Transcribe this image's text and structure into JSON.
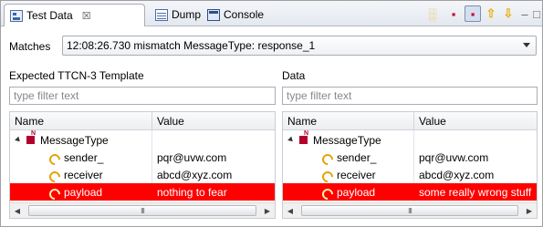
{
  "tabs": [
    {
      "label": "Test Data",
      "icon": "test-data-icon",
      "close": "☒"
    },
    {
      "label": "Dump",
      "icon": "dump-icon"
    },
    {
      "label": "Console",
      "icon": "console-icon"
    }
  ],
  "toolbar": {
    "icons": [
      "error-filter-icon",
      "type-filter-icon",
      "show-type-icon",
      "previous-icon",
      "next-icon",
      "minimize-icon",
      "maximize-icon"
    ]
  },
  "matches": {
    "label": "Matches",
    "selected": "12:08:26.730 mismatch MessageType: response_1"
  },
  "left": {
    "title": "Expected TTCN-3 Template",
    "filter_placeholder": "type filter text",
    "col_name": "Name",
    "col_value": "Value",
    "rows": [
      {
        "name": "MessageType",
        "value": ""
      },
      {
        "name": "sender_",
        "value": "pqr@uvw.com"
      },
      {
        "name": "receiver",
        "value": "abcd@xyz.com"
      },
      {
        "name": "payload",
        "value": "nothing to fear"
      }
    ]
  },
  "right": {
    "title": "Data",
    "filter_placeholder": "type filter text",
    "col_name": "Name",
    "col_value": "Value",
    "rows": [
      {
        "name": "MessageType",
        "value": ""
      },
      {
        "name": "sender_",
        "value": "pqr@uvw.com"
      },
      {
        "name": "receiver",
        "value": "abcd@xyz.com"
      },
      {
        "name": "payload",
        "value": "some really wrong stuff"
      }
    ]
  },
  "colors": {
    "mismatch_row": "#ff0000",
    "type_icon": "#b3002d",
    "field_icon": "#e1a400"
  },
  "scroll_grip": "III"
}
